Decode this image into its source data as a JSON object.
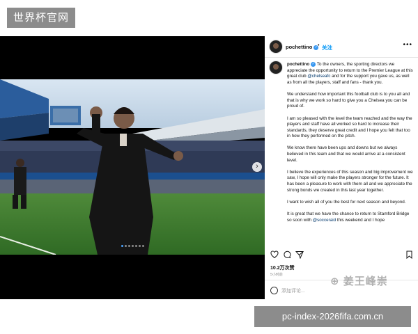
{
  "watermark_top": "世界杯官网",
  "watermark_bottom": "pc-index-2026fifa.com.cn",
  "watermark_logo": "姜王峰崇",
  "post": {
    "username": "pochettino",
    "follow_label": "关注",
    "more_icon": "more-horizontal-icon",
    "caption_paragraphs": [
      " To the owners, the sporting directors we appreciate the opportunity to return to the Premier League at this great club ",
      "We understand how important this football club is to you all and that is why we work so hard to give you a Chelsea you can be proud of.",
      "I am so pleased with the level the team reached and the way the players and staff have all worked so hard to increase their standards, they deserve great credit and I hope you felt that too in how they performed on the pitch.",
      "We know there have been ups and downs but we always believed in this team and that we would arrive at a consistent level.",
      "I believe the experiences of this season and big improvement we saw, I hope will only make the players stronger for the future. It has been a pleasure to work with them all and we appreciate the strong bonds we created in this last year together.",
      "I want to wish all of you the best for next season and beyond.",
      "It is great that we have the chance to return to Stamford Bridge so soon with "
    ],
    "caption_mention_1": "@chelseafc",
    "caption_after_mention_1": " and for the support you gave us, as well as from all the players, staff and fans - thank you.",
    "caption_mention_2": "@socceraid",
    "caption_after_mention_2": " this weekend and I hope",
    "likes": "10.2万次赞",
    "time": "5小时前",
    "add_comment_placeholder": "添加评论...",
    "carousel_total": 7,
    "carousel_active": 1,
    "next_arrow": "›",
    "verified_mark": "✓"
  }
}
